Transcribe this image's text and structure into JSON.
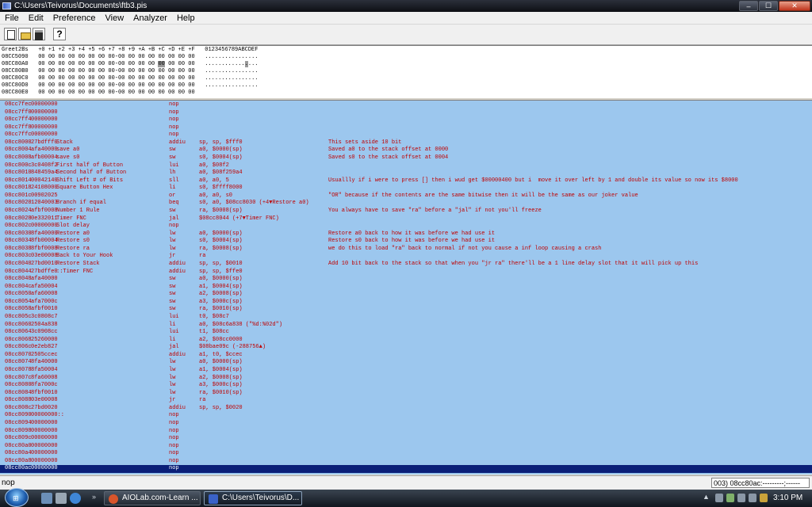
{
  "window": {
    "title": "C:\\Users\\Teivorus\\Documents\\ftb3.pis",
    "minimize": "–",
    "maximize": "☐",
    "close": "✕"
  },
  "menu": [
    "File",
    "Edit",
    "Preference",
    "View",
    "Analyzer",
    "Help"
  ],
  "toolbar": {
    "buttons": [
      {
        "name": "new-file-icon"
      },
      {
        "name": "open-file-icon"
      },
      {
        "name": "save-file-icon"
      },
      {
        "name": "help-icon",
        "glyph": "?"
      }
    ]
  },
  "hex": {
    "header": "Greet2Bs   +0 +1 +2 +3 +4 +5 +6 +7 +8 +9 +A +B +C +D +E +F   0123456789ABCDEF",
    "rows": [
      {
        "addr": "08CC5090",
        "bytes": "00 00 00 00 00 00 00 00-00 00 00 00 00 00 00 00",
        "ascii": "................"
      },
      {
        "addr": "08CC80A0",
        "bytes": "00 00 00 00 00 00 00 00-00 00 00 00",
        "sel": "00",
        "rest": "00 00 00",
        "ascii": "............",
        "asciisel": ".",
        "asciirest": "..."
      },
      {
        "addr": "08CC80B0",
        "bytes": "00 00 00 00 00 00 00 00-00 00 00 00 00 00 00 00",
        "ascii": "................"
      },
      {
        "addr": "08CC80C0",
        "bytes": "00 00 00 00 00 00 00 00-00 00 00 00 00 00 00 00",
        "ascii": "................"
      },
      {
        "addr": "08CC80D0",
        "bytes": "00 00 00 00 00 00 00 00-00 00 00 00 00 00 00 00",
        "ascii": "................"
      },
      {
        "addr": "08CC80E0",
        "bytes": "00 00 00 00 00 00 00 00-00 00 00 00 00 00 00 00",
        "ascii": ""
      }
    ]
  },
  "disasm": [
    {
      "addr": "08cc7fec",
      "hex": "00000000",
      "label": "",
      "op": "nop",
      "args": "",
      "cmt": ""
    },
    {
      "addr": "08cc7ff0",
      "hex": "00000000",
      "label": "",
      "op": "nop",
      "args": "",
      "cmt": ""
    },
    {
      "addr": "08cc7ff4",
      "hex": "00000000",
      "label": "",
      "op": "nop",
      "args": "",
      "cmt": ""
    },
    {
      "addr": "08cc7ff8",
      "hex": "00000000",
      "label": "",
      "op": "nop",
      "args": "",
      "cmt": ""
    },
    {
      "addr": "08cc7ffc",
      "hex": "00000000",
      "label": "",
      "op": "nop",
      "args": "",
      "cmt": ""
    },
    {
      "addr": "08cc8000",
      "hex": "27bdfff0",
      "label": "Stack",
      "op": "addiu",
      "args": "sp, sp, $fff0",
      "cmt": "This sets aside 10 bit"
    },
    {
      "addr": "08cc8004",
      "hex": "afa40000",
      "label": "save a0",
      "op": "sw",
      "args": "a0, $0000(sp)",
      "cmt": "Saved a0 to the stack offset at 0000"
    },
    {
      "addr": "08cc8008",
      "hex": "afb00004",
      "label": "save s0",
      "op": "sw",
      "args": "s0, $0004(sp)",
      "cmt": "Saved s0 to the stack offset at 0004"
    },
    {
      "addr": "08cc800c",
      "hex": "3c0408f2",
      "label": "First half of Button",
      "op": "lui",
      "args": "a0, $08f2",
      "cmt": ""
    },
    {
      "addr": "08cc8010",
      "hex": "848459a4",
      "label": "Second half of Button",
      "op": "lh",
      "args": "a0, $08f259a4",
      "cmt": ""
    },
    {
      "addr": "08cc8014",
      "hex": "00042140",
      "label": "Shift Left # of Bits",
      "op": "sll",
      "args": "a0, a0, 5",
      "cmt": "Usuallly if i were to press [] then i wud get $00000400 but i  move it over left by 1 and double its value so now its $8000"
    },
    {
      "addr": "08cc8018",
      "hex": "24108000",
      "label": "Square Button Hex",
      "op": "li",
      "args": "s0, $ffff8000",
      "cmt": ""
    },
    {
      "addr": "08cc801c",
      "hex": "00902025",
      "label": "",
      "op": "or",
      "args": "a0, a0, s0",
      "cmt": "\"OR\" because if the contents are the same bitwise then it will be the same as our joker value"
    },
    {
      "addr": "08cc8020",
      "hex": "12040003",
      "label": "Branch if equal",
      "op": "beq",
      "args": "s0, a0, $08cc8030 (+4▼Restore a0)",
      "cmt": ""
    },
    {
      "addr": "08cc8024",
      "hex": "afbf0008",
      "label": "Number 1 Rule",
      "op": "sw",
      "args": "ra, $0008(sp)",
      "cmt": "You always have to save \"ra\" before a \"jal\" if not you'll freeze"
    },
    {
      "addr": "08cc8028",
      "hex": "0e332011",
      "label": "Timer FNC",
      "op": "jal",
      "args": "$08cc8044 (+7▼Timer FNC)",
      "cmt": ""
    },
    {
      "addr": "08cc802c",
      "hex": "00000000",
      "label": "Slot delay",
      "op": "nop",
      "args": "",
      "cmt": ""
    },
    {
      "addr": "08cc8030",
      "hex": "8fa40000",
      "label": "Restore a0",
      "op": "lw",
      "args": "a0, $0000(sp)",
      "cmt": "Restore a0 back to how it was before we had use it"
    },
    {
      "addr": "08cc8034",
      "hex": "8fb00004",
      "label": "Restore s0",
      "op": "lw",
      "args": "s0, $0004(sp)",
      "cmt": "Restore s0 back to how it was before we had use it"
    },
    {
      "addr": "08cc8038",
      "hex": "8fbf0008",
      "label": "Restore ra",
      "op": "lw",
      "args": "ra, $0008(sp)",
      "cmt": "we do this to load \"ra\" back to normal if not you cause a inf loop causing a crash"
    },
    {
      "addr": "08cc803c",
      "hex": "03e00008",
      "label": "Back to Your Hook",
      "op": "jr",
      "args": "ra",
      "cmt": ""
    },
    {
      "addr": "08cc8040",
      "hex": "27bd0010",
      "label": "Restore Stack",
      "op": "addiu",
      "args": "sp, sp, $0010",
      "cmt": "Add 10 bit back to the stack so that when you \"jr ra\" there'll be a 1 line delay slot that it will pick up this"
    },
    {
      "addr": "08cc8044",
      "hex": "27bdffe0",
      "label": "::Timer FNC",
      "op": "addiu",
      "args": "sp, sp, $ffe0",
      "cmt": ""
    },
    {
      "addr": "08cc8048",
      "hex": "afa40000",
      "label": "",
      "op": "sw",
      "args": "a0, $0000(sp)",
      "cmt": ""
    },
    {
      "addr": "08cc804c",
      "hex": "afa50004",
      "label": "",
      "op": "sw",
      "args": "a1, $0004(sp)",
      "cmt": ""
    },
    {
      "addr": "08cc8050",
      "hex": "afa60008",
      "label": "",
      "op": "sw",
      "args": "a2, $0008(sp)",
      "cmt": ""
    },
    {
      "addr": "08cc8054",
      "hex": "afa7000c",
      "label": "",
      "op": "sw",
      "args": "a3, $000c(sp)",
      "cmt": ""
    },
    {
      "addr": "08cc8058",
      "hex": "afbf0010",
      "label": "",
      "op": "sw",
      "args": "ra, $0010(sp)",
      "cmt": ""
    },
    {
      "addr": "08cc805c",
      "hex": "3c0808c7",
      "label": "",
      "op": "lui",
      "args": "t0, $08c7",
      "cmt": ""
    },
    {
      "addr": "08cc8060",
      "hex": "2504a838",
      "label": "",
      "op": "li",
      "args": "a0, $08c6a838 (\"%d:%02d\")",
      "cmt": ""
    },
    {
      "addr": "08cc8064",
      "hex": "3c0908cc",
      "label": "",
      "op": "lui",
      "args": "t1, $08cc",
      "cmt": ""
    },
    {
      "addr": "08cc8068",
      "hex": "25260000",
      "label": "",
      "op": "li",
      "args": "a2, $08cc0000",
      "cmt": ""
    },
    {
      "addr": "08cc806c",
      "hex": "0e2eb827",
      "label": "",
      "op": "jal",
      "args": "$08bae09c (-288756▲)",
      "cmt": ""
    },
    {
      "addr": "08cc8070",
      "hex": "2505ccec",
      "label": "",
      "op": "addiu",
      "args": "a1, t0, $ccec",
      "cmt": ""
    },
    {
      "addr": "08cc8074",
      "hex": "8fa40000",
      "label": "",
      "op": "lw",
      "args": "a0, $0000(sp)",
      "cmt": ""
    },
    {
      "addr": "08cc8078",
      "hex": "8fa50004",
      "label": "",
      "op": "lw",
      "args": "a1, $0004(sp)",
      "cmt": ""
    },
    {
      "addr": "08cc807c",
      "hex": "8fa60008",
      "label": "",
      "op": "lw",
      "args": "a2, $0008(sp)",
      "cmt": ""
    },
    {
      "addr": "08cc8080",
      "hex": "8fa7000c",
      "label": "",
      "op": "lw",
      "args": "a3, $000c(sp)",
      "cmt": ""
    },
    {
      "addr": "08cc8084",
      "hex": "8fbf0010",
      "label": "",
      "op": "lw",
      "args": "ra, $0010(sp)",
      "cmt": ""
    },
    {
      "addr": "08cc8088",
      "hex": "03e00008",
      "label": "",
      "op": "jr",
      "args": "ra",
      "cmt": ""
    },
    {
      "addr": "08cc808c",
      "hex": "27bd0020",
      "label": "",
      "op": "addiu",
      "args": "sp, sp, $0020",
      "cmt": ""
    },
    {
      "addr": "08cc8090",
      "hex": "00000000::",
      "label": "",
      "op": "nop",
      "args": "",
      "cmt": ""
    },
    {
      "addr": "08cc8094",
      "hex": "00000000",
      "label": "",
      "op": "nop",
      "args": "",
      "cmt": ""
    },
    {
      "addr": "08cc8098",
      "hex": "00000000",
      "label": "",
      "op": "nop",
      "args": "",
      "cmt": ""
    },
    {
      "addr": "08cc809c",
      "hex": "00000000",
      "label": "",
      "op": "nop",
      "args": "",
      "cmt": ""
    },
    {
      "addr": "08cc80a0",
      "hex": "00000000",
      "label": "",
      "op": "nop",
      "args": "",
      "cmt": ""
    },
    {
      "addr": "08cc80a4",
      "hex": "00000000",
      "label": "",
      "op": "nop",
      "args": "",
      "cmt": ""
    },
    {
      "addr": "08cc80a8",
      "hex": "00000000",
      "label": "",
      "op": "nop",
      "args": "",
      "cmt": ""
    },
    {
      "addr": "08cc80ac",
      "hex": "00000000",
      "label": "",
      "op": "nop",
      "args": "",
      "cmt": "",
      "selected": true
    }
  ],
  "status": {
    "left": "nop",
    "right": "003) 08cc80ac:---------;------"
  },
  "taskbar": {
    "tasks": [
      {
        "label": "AIOLab.com-Learn ...",
        "active": false,
        "color": "#d9552b"
      },
      {
        "label": "C:\\Users\\Teivorus\\D...",
        "active": true,
        "color": "#3a62c8"
      }
    ],
    "clock": "3:10 PM"
  }
}
